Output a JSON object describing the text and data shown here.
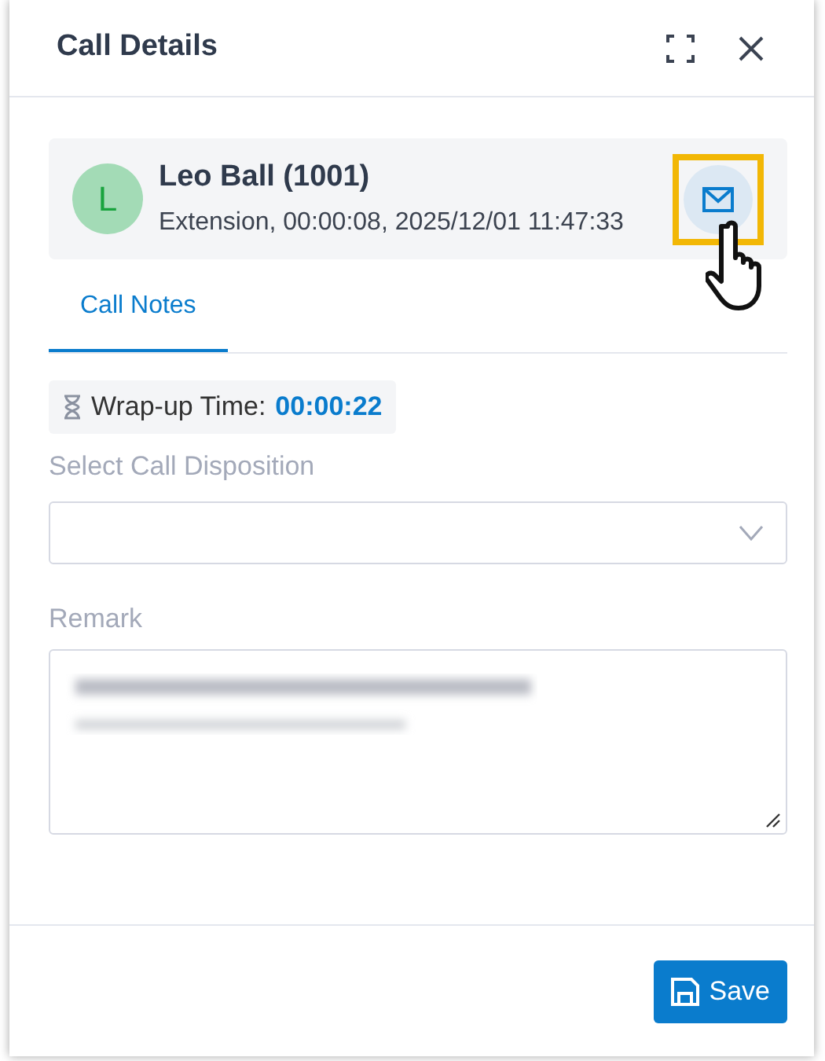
{
  "dialog": {
    "title": "Call Details"
  },
  "contact": {
    "initial": "L",
    "name": "Leo Ball (1001)",
    "details": "Extension, 00:00:08, 2025/12/01 11:47:33",
    "email_highlighted": true
  },
  "tabs": [
    {
      "label": "Call Notes",
      "selected": true
    }
  ],
  "wrap_up": {
    "label": "Wrap-up Time:",
    "value": "00:00:22"
  },
  "disposition": {
    "label": "Select Call Disposition"
  },
  "remark": {
    "label": "Remark"
  },
  "buttons": [
    {
      "label": "Save"
    }
  ]
}
